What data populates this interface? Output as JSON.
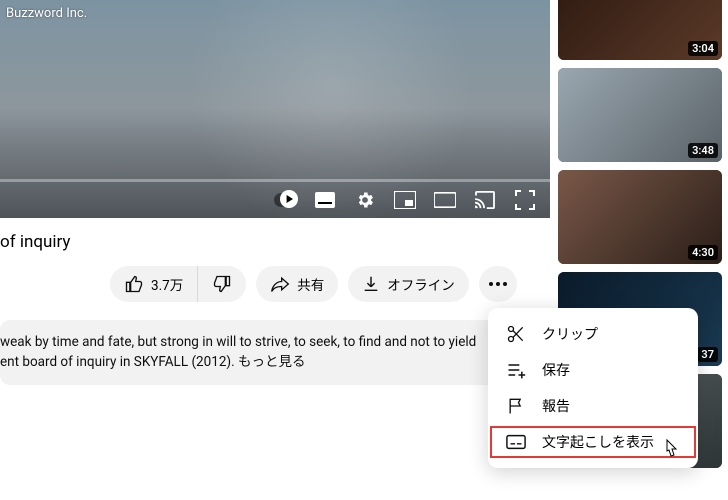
{
  "channel_name": "Buzzword Inc.",
  "title_suffix": "of inquiry",
  "actions": {
    "like_count": "3.7万",
    "share": "共有",
    "download": "オフライン"
  },
  "description": {
    "line1": "weak by time and fate, but strong in will to strive, to seek, to find and not to yield",
    "line2": "ent board of inquiry in SKYFALL (2012). ",
    "more": "もっと見る"
  },
  "menu": {
    "clip": "クリップ",
    "save": "保存",
    "report": "報告",
    "transcript": "文字起こしを表示"
  },
  "sidebar": {
    "items": [
      {
        "duration": "3:04",
        "bg": "linear-gradient(135deg,#2c1810,#5b3a28)"
      },
      {
        "duration": "3:48",
        "bg": "linear-gradient(135deg,#9aa7b0,#5a6268)"
      },
      {
        "duration": "4:30",
        "bg": "linear-gradient(135deg,#7a5848,#2a1e18)"
      },
      {
        "duration": "37",
        "bg": "linear-gradient(135deg,#0a1a2a,#1a3a52)"
      },
      {
        "duration": "",
        "bg": "linear-gradient(135deg,#6a7272,#2d3436)"
      }
    ]
  }
}
